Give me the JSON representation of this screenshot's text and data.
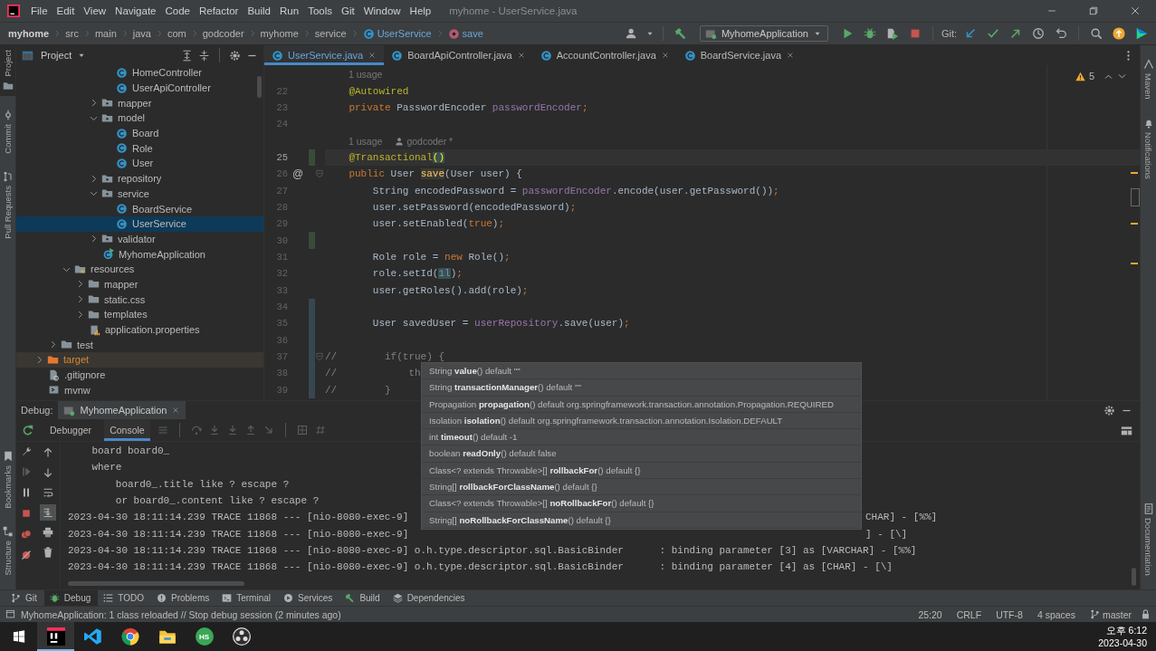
{
  "title_bar": {
    "menu": [
      "File",
      "Edit",
      "View",
      "Navigate",
      "Code",
      "Refactor",
      "Build",
      "Run",
      "Tools",
      "Git",
      "Window",
      "Help"
    ],
    "title": "myhome - UserService.java"
  },
  "breadcrumbs": [
    {
      "label": "myhome",
      "kind": "project"
    },
    {
      "label": "src",
      "kind": "dir"
    },
    {
      "label": "main",
      "kind": "dir"
    },
    {
      "label": "java",
      "kind": "dir"
    },
    {
      "label": "com",
      "kind": "dir"
    },
    {
      "label": "godcoder",
      "kind": "dir"
    },
    {
      "label": "myhome",
      "kind": "dir"
    },
    {
      "label": "service",
      "kind": "dir"
    },
    {
      "label": "UserService",
      "kind": "class"
    },
    {
      "label": "save",
      "kind": "method"
    }
  ],
  "toolbar": {
    "run_config": "MyhomeApplication",
    "git_label": "Git:"
  },
  "left_tools_top": [
    {
      "label": "Project",
      "selected": true
    },
    {
      "label": "Commit",
      "selected": false
    },
    {
      "label": "Pull Requests",
      "selected": false
    }
  ],
  "left_tools_bottom": [
    {
      "label": "Bookmarks",
      "kind": "bookmark"
    },
    {
      "label": "Structure",
      "kind": "structure"
    }
  ],
  "right_tools_top": [
    "Maven",
    "Notifications"
  ],
  "right_tools_bottom": [
    "Documentation"
  ],
  "project": {
    "title": "Project",
    "tree": [
      {
        "children": [
          {
            "children": [
              {
                "children": [
                  {
                    "children": [
                      {
                        "children": [
                          {
                            "label": "HomeController",
                            "kind": "class",
                            "selected": false
                          },
                          {
                            "label": "UserApiController",
                            "kind": "class",
                            "selected": false
                          }
                        ]
                      },
                      {
                        "label": "mapper",
                        "kind": "package",
                        "expanded": false,
                        "selected": false
                      },
                      {
                        "label": "model",
                        "kind": "package",
                        "expanded": true,
                        "selected": false,
                        "children": [
                          {
                            "label": "Board",
                            "kind": "class",
                            "selected": false
                          },
                          {
                            "label": "Role",
                            "kind": "class",
                            "selected": false
                          },
                          {
                            "label": "User",
                            "kind": "class",
                            "selected": false
                          }
                        ]
                      },
                      {
                        "label": "repository",
                        "kind": "package",
                        "expanded": false,
                        "selected": false
                      },
                      {
                        "label": "service",
                        "kind": "package",
                        "expanded": true,
                        "selected": false,
                        "children": [
                          {
                            "label": "BoardService",
                            "kind": "class",
                            "selected": false
                          },
                          {
                            "label": "UserService",
                            "kind": "class",
                            "selected": true
                          }
                        ]
                      },
                      {
                        "label": "validator",
                        "kind": "package",
                        "expanded": false,
                        "selected": false
                      },
                      {
                        "label": "MyhomeApplication",
                        "kind": "app",
                        "selected": false
                      }
                    ]
                  }
                ]
              },
              {
                "label": "resources",
                "kind": "resources",
                "expanded": true,
                "selected": false,
                "children": [
                  {
                    "label": "mapper",
                    "kind": "folder",
                    "expanded": false,
                    "selected": false
                  },
                  {
                    "label": "static.css",
                    "kind": "folder",
                    "expanded": false,
                    "selected": false
                  },
                  {
                    "label": "templates",
                    "kind": "folder",
                    "expanded": false,
                    "selected": false
                  },
                  {
                    "label": "application.properties",
                    "kind": "properties",
                    "selected": false
                  }
                ]
              }
            ]
          },
          {
            "label": "test",
            "kind": "folder",
            "expanded": false,
            "selected": false
          }
        ]
      },
      {
        "label": "target",
        "kind": "excluded",
        "expanded": false,
        "selected": false
      },
      {
        "label": ".gitignore",
        "kind": "ignore",
        "selected": false
      },
      {
        "label": "mvnw",
        "kind": "script",
        "selected": false
      }
    ]
  },
  "editor": {
    "tabs": [
      {
        "label": "UserService.java",
        "selected": true
      },
      {
        "label": "BoardApiController.java",
        "selected": false
      },
      {
        "label": "AccountController.java",
        "selected": false
      },
      {
        "label": "BoardService.java",
        "selected": false
      }
    ],
    "warnings": "5",
    "lines": [
      {
        "kind": "hint",
        "text": "1 usage"
      },
      {
        "kind": "code",
        "number": "22",
        "current": false,
        "tokens": [
          {
            "t": "    @Autowired",
            "kind": "ann"
          }
        ]
      },
      {
        "kind": "code",
        "number": "23",
        "current": false,
        "tokens": [
          {
            "t": "    private",
            "kind": "kw"
          },
          {
            "t": " PasswordEncoder "
          },
          {
            "t": "passwordEncoder",
            "kind": "field"
          },
          {
            "t": ";",
            "kind": "kw"
          }
        ]
      },
      {
        "kind": "code",
        "number": "24",
        "current": false
      },
      {
        "kind": "hint",
        "text": "1 usage",
        "author": "godcoder *"
      },
      {
        "kind": "code",
        "number": "25",
        "current": true,
        "added": true,
        "tokens": [
          {
            "t": "    @Transactional",
            "kind": "ann"
          },
          {
            "t": "()",
            "kind": "brace"
          }
        ]
      },
      {
        "kind": "code",
        "number": "26",
        "current": false,
        "gutter": "@",
        "fold": true,
        "tokens": [
          {
            "t": "    public",
            "kind": "kw"
          },
          {
            "t": " User "
          },
          {
            "t": "save",
            "kind": "hl"
          },
          {
            "t": "(User user) {"
          }
        ]
      },
      {
        "kind": "code",
        "number": "27",
        "current": false,
        "tokens": [
          {
            "t": "        String encodedPassword = "
          },
          {
            "t": "passwordEncoder",
            "kind": "field"
          },
          {
            "t": ".encode(user.getPassword())"
          },
          {
            "t": ";",
            "kind": "kw"
          }
        ]
      },
      {
        "kind": "code",
        "number": "28",
        "current": false,
        "tokens": [
          {
            "t": "        user.setPassword(encodedPassword)"
          },
          {
            "t": ";",
            "kind": "kw"
          }
        ]
      },
      {
        "kind": "code",
        "number": "29",
        "current": false,
        "tokens": [
          {
            "t": "        user.setEnabled("
          },
          {
            "t": "true",
            "kind": "kw"
          },
          {
            "t": ")"
          },
          {
            "t": ";",
            "kind": "kw"
          }
        ]
      },
      {
        "kind": "code",
        "number": "30",
        "current": false,
        "added": true
      },
      {
        "kind": "code",
        "number": "31",
        "current": false,
        "tokens": [
          {
            "t": "        Role role = "
          },
          {
            "t": "new",
            "kind": "kw"
          },
          {
            "t": " Role()"
          },
          {
            "t": ";",
            "kind": "kw"
          }
        ]
      },
      {
        "kind": "code",
        "number": "32",
        "current": false,
        "tokens": [
          {
            "t": "        role.setId("
          },
          {
            "t": "1l",
            "kind": "num"
          },
          {
            "t": ")"
          },
          {
            "t": ";",
            "kind": "kw"
          }
        ]
      },
      {
        "kind": "code",
        "number": "33",
        "current": false,
        "tokens": [
          {
            "t": "        user.getRoles().add(role)"
          },
          {
            "t": ";",
            "kind": "kw"
          }
        ]
      },
      {
        "kind": "code",
        "number": "34",
        "current": false,
        "modified": true
      },
      {
        "kind": "code",
        "number": "35",
        "current": false,
        "modified": true,
        "tokens": [
          {
            "t": "        User savedUser = "
          },
          {
            "t": "userRepository",
            "kind": "field"
          },
          {
            "t": ".save(user)"
          },
          {
            "t": ";",
            "kind": "kw"
          }
        ]
      },
      {
        "kind": "code",
        "number": "36",
        "current": false,
        "modified": true
      },
      {
        "kind": "code",
        "number": "37",
        "current": false,
        "modified": true,
        "fold": true,
        "tokens": [
          {
            "t": "//        if(true) {",
            "kind": "comment"
          }
        ]
      },
      {
        "kind": "code",
        "number": "38",
        "current": false,
        "modified": true,
        "tokens": [
          {
            "t": "//            th",
            "kind": "comment"
          }
        ]
      },
      {
        "kind": "code",
        "number": "39",
        "current": false,
        "modified": true,
        "tokens": [
          {
            "t": "//        }",
            "kind": "comment"
          }
        ]
      }
    ]
  },
  "completion_popup": [
    "String **value**() default \"\"",
    "String **transactionManager**() default \"\"",
    "Propagation **propagation**() default org.springframework.transaction.annotation.Propagation.REQUIRED",
    "Isolation **isolation**() default org.springframework.transaction.annotation.Isolation.DEFAULT",
    "int **timeout**() default -1",
    "boolean **readOnly**() default false",
    "Class<? extends Throwable>[] **rollbackFor**() default {}",
    "String[] **rollbackForClassName**() default {}",
    "Class<? extends Throwable>[] **noRollbackFor**() default {}",
    "String[] **noRollbackForClassName**() default {}"
  ],
  "debug": {
    "label": "Debug:",
    "session": "MyhomeApplication",
    "tabs": [
      {
        "label": "Debugger",
        "selected": false
      },
      {
        "label": "Console",
        "selected": true
      }
    ],
    "console": [
      {
        "text": "    board board0_"
      },
      {
        "text": "    where"
      },
      {
        "text": "        board0_.title like ? escape ?"
      },
      {
        "text": "        or board0_.content like ? escape ?"
      },
      {
        "text": "2023-04-30 18:11:14.239 TRACE 11868 --- [nio-8080-exec-9]",
        "tail": "CHAR] - [%%]"
      },
      {
        "text": "2023-04-30 18:11:14.239 TRACE 11868 --- [nio-8080-exec-9]",
        "tail": "] - [\\]"
      },
      {
        "text": "2023-04-30 18:11:14.239 TRACE 11868 --- [nio-8080-exec-9] o.h.type.descriptor.sql.BasicBinder      : binding parameter [3] as [VARCHAR] - [%%]"
      },
      {
        "text": "2023-04-30 18:11:14.239 TRACE 11868 --- [nio-8080-exec-9] o.h.type.descriptor.sql.BasicBinder      : binding parameter [4] as [CHAR] - [\\]"
      }
    ]
  },
  "tool_windows": [
    {
      "label": "Git",
      "kind": "git",
      "selected": false
    },
    {
      "label": "Debug",
      "kind": "debug",
      "selected": true
    },
    {
      "label": "TODO",
      "kind": "todo",
      "selected": false
    },
    {
      "label": "Problems",
      "kind": "problems",
      "selected": false
    },
    {
      "label": "Terminal",
      "kind": "terminal",
      "selected": false
    },
    {
      "label": "Services",
      "kind": "services",
      "selected": false
    },
    {
      "label": "Build",
      "kind": "build",
      "selected": false
    },
    {
      "label": "Dependencies",
      "kind": "dependencies",
      "selected": false
    }
  ],
  "status_bar": {
    "message": "MyhomeApplication: 1 class reloaded // Stop debug session (2 minutes ago)",
    "items": [
      "25:20",
      "CRLF",
      "UTF-8",
      "4 spaces"
    ],
    "branch": "master"
  },
  "taskbar": {
    "apps": [
      {
        "kind": "ide",
        "active": true
      },
      {
        "kind": "code",
        "active": false
      },
      {
        "kind": "browser",
        "active": false
      },
      {
        "kind": "files",
        "active": false
      },
      {
        "kind": "hs",
        "label": "HS",
        "active": false
      },
      {
        "kind": "obs",
        "active": false
      }
    ],
    "time": "오후 6:12",
    "date": "2023-04-30"
  }
}
